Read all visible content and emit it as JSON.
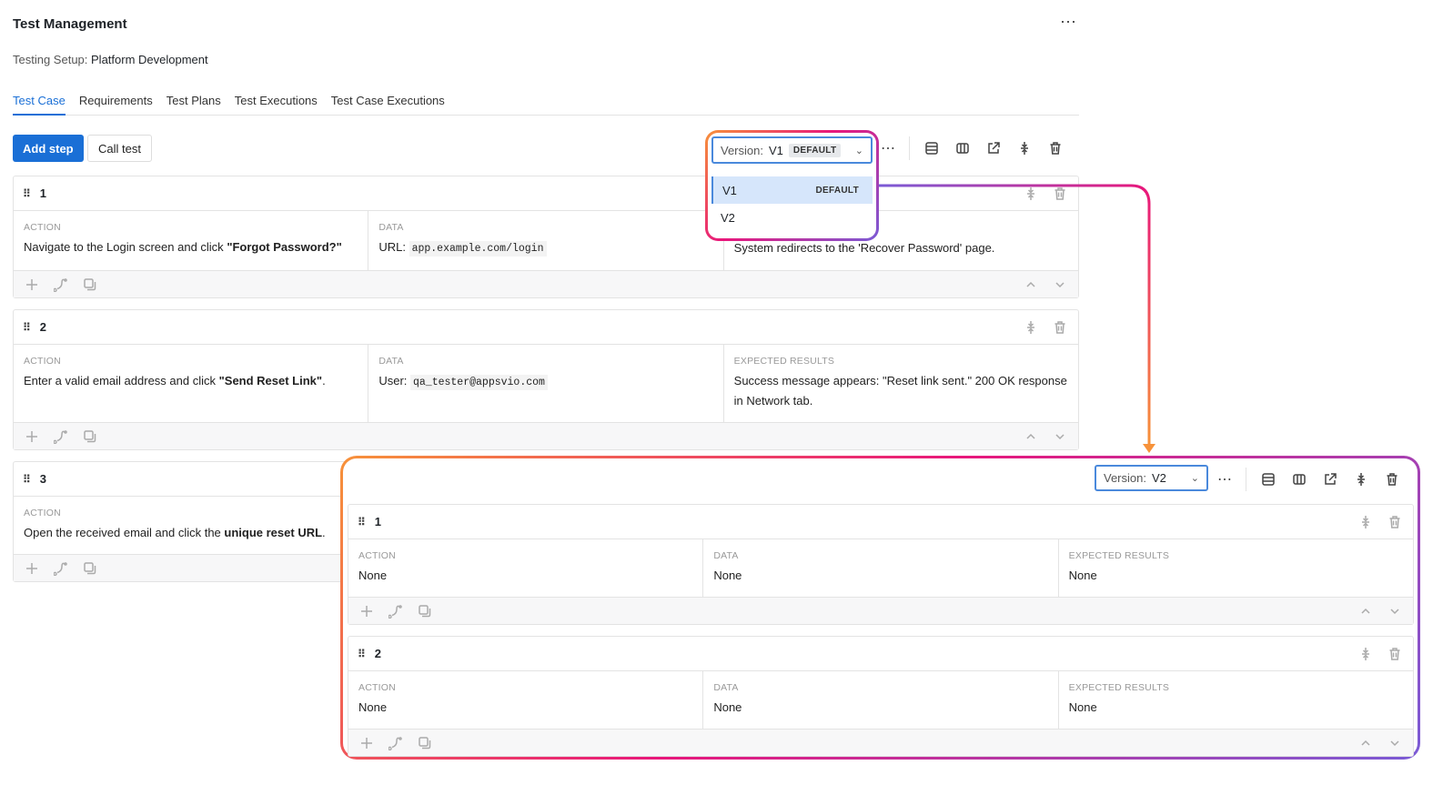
{
  "header": {
    "title": "Test Management",
    "setup_label": "Testing Setup:",
    "setup_value": "Platform Development",
    "more": "⋯"
  },
  "tabs": [
    {
      "label": "Test Case",
      "active": true
    },
    {
      "label": "Requirements"
    },
    {
      "label": "Test Plans"
    },
    {
      "label": "Test Executions"
    },
    {
      "label": "Test Case Executions"
    }
  ],
  "toolbar": {
    "add_step": "Add step",
    "call_test": "Call test",
    "version_label": "Version:",
    "version_value": "V1",
    "default_badge": "DEFAULT",
    "more": "⋯"
  },
  "dropdown": {
    "options": [
      {
        "label": "V1",
        "badge": "DEFAULT",
        "selected": true
      },
      {
        "label": "V2"
      }
    ]
  },
  "columns": {
    "action": "ACTION",
    "data": "DATA",
    "expected": "EXPECTED RESULTS"
  },
  "steps": [
    {
      "number": "1",
      "action": [
        [
          "Navigate to the Login screen and click ",
          ""
        ],
        [
          "\"Forgot Password?\"",
          "b"
        ]
      ],
      "data": [
        [
          "URL: ",
          ""
        ],
        [
          "app.example.com/login",
          "code"
        ]
      ],
      "expected": [
        [
          "System redirects to the 'Recover Password' page.",
          ""
        ]
      ],
      "hide_expected_label": true
    },
    {
      "number": "2",
      "action": [
        [
          "Enter a valid email address and click ",
          ""
        ],
        [
          "\"Send Reset Link\"",
          "b"
        ],
        [
          ".",
          ""
        ]
      ],
      "data": [
        [
          "User: ",
          ""
        ],
        [
          "qa_tester@appsvio.com",
          "code"
        ]
      ],
      "expected": [
        [
          "Success message appears: \"Reset link sent.\" 200 OK response in Network tab.",
          ""
        ]
      ]
    },
    {
      "number": "3",
      "action": [
        [
          "Open the received email and click the ",
          ""
        ],
        [
          "unique reset URL",
          "b"
        ],
        [
          ".",
          ""
        ]
      ]
    }
  ],
  "v2_panel": {
    "version_label": "Version:",
    "version_value": "V2",
    "more": "⋯",
    "steps": [
      {
        "number": "1",
        "action": [
          [
            "None",
            ""
          ]
        ],
        "data": [
          [
            "None",
            ""
          ]
        ],
        "expected": [
          [
            "None",
            ""
          ]
        ]
      },
      {
        "number": "2",
        "action": [
          [
            "None",
            ""
          ]
        ],
        "data": [
          [
            "None",
            ""
          ]
        ],
        "expected": [
          [
            "None",
            ""
          ]
        ]
      }
    ]
  },
  "colors": {
    "accent": "#1a6fd6",
    "highlight_gradient": [
      "#f7923a",
      "#e8177b",
      "#7a5bd6"
    ]
  }
}
